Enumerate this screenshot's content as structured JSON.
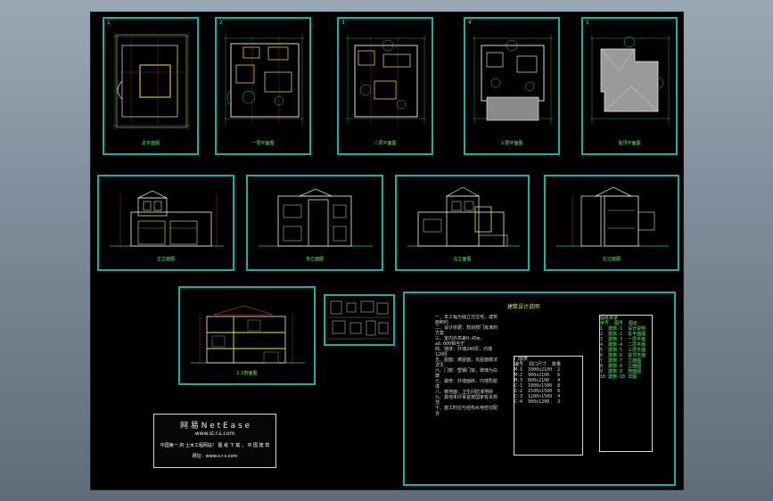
{
  "viewer": {
    "background_colors": [
      "#9aa7b5",
      "#5f6c79"
    ],
    "canvas_color": "#000000",
    "frame_color": "#11b3a6"
  },
  "watermark": {
    "line1": "网 易   N e t E a s e",
    "line2": "www.sl.r.s.com",
    "line3": "中国第一 的 土木工程网站！ 图 纸 下 载 ， 中 国 建 筑",
    "line4": "网址：www.s.r.s.com"
  },
  "sheets": {
    "plans": [
      {
        "number": "1",
        "label": "总平面图"
      },
      {
        "number": "2",
        "label": "一层平面图"
      },
      {
        "number": "3",
        "label": "二层平面图"
      },
      {
        "number": "4",
        "label": "三层平面图"
      },
      {
        "number": "5",
        "label": "屋顶平面图"
      }
    ],
    "elevations": [
      {
        "label": "正立面图"
      },
      {
        "label": "背立面图"
      },
      {
        "label": "左立面图"
      },
      {
        "label": "右立面图"
      }
    ],
    "section": {
      "label": "1-1剖面图"
    },
    "notes": {
      "title": "建筑设计说明",
      "col1": "一、本工程为独立式住宅，建筑面积约\n二、设计依据：规划部门批准的方案\n三、室内外高差0.45m，±0.000相当于\n四、墙体：外墙240厚，内墙120厚\n五、屋面：坡屋面，瓦屋面做法详见\n六、门窗：塑钢门窗，玻璃为白玻\n七、装修：外墙面砖，内墙乳胶漆\n八、楼地面：卫生间防滑地砖\n九、其他未尽事宜按国家有关规范\n十、施工时应与结构水电密切配合",
      "col2": "门窗表\n编号  洞口尺寸  数量\nM-1  1000x2100  2\nM-2  900x2100   6\nM-3  800x2100   4\nC-1  1800x1500  8\nC-2  1500x1500  6\nC-3  1200x1500  4\nC-4  900x1200   3",
      "col3": "图纸目录\n序号  图号  图名\n1  建施-1  设计说明\n2  建施-2  总平面图\n3  建施-3  一层平面\n4  建施-4  二层平面\n5  建施-5  三层平面\n6  建施-6  屋顶平面\n7  建施-7  立面图\n8  建施-8  立面图\n9  建施-9  剖面图\n10 建施-10 详图"
    }
  }
}
